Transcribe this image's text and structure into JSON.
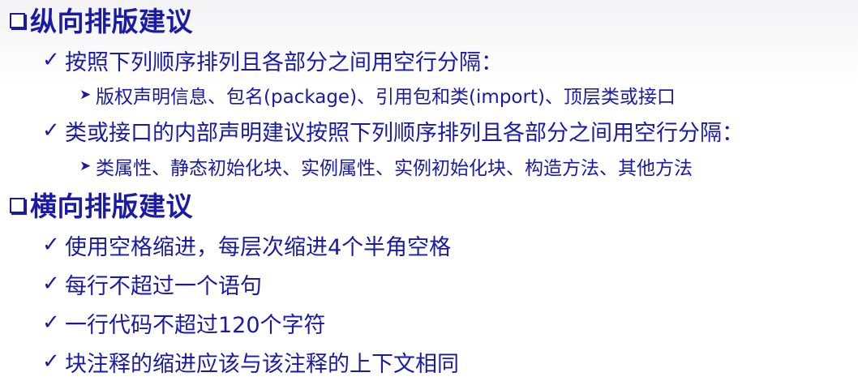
{
  "sections": [
    {
      "heading": "纵向排版建议",
      "bullets": [
        {
          "text": "按照下列顺序排列且各部分之间用空行分隔：",
          "sub": "版权声明信息、包名(package)、引用包和类(import)、顶层类或接口"
        },
        {
          "text": "类或接口的内部声明建议按照下列顺序排列且各部分之间用空行分隔：",
          "sub": "类属性、静态初始化块、实例属性、实例初始化块、构造方法、其他方法"
        }
      ]
    },
    {
      "heading": "横向排版建议",
      "bullets": [
        {
          "text": "使用空格缩进，每层次缩进4个半角空格"
        },
        {
          "text": "每行不超过一个语句"
        },
        {
          "text": "一行代码不超过120个字符"
        },
        {
          "text": "块注释的缩进应该与该注释的上下文相同"
        }
      ]
    }
  ],
  "icons": {
    "heading_bullet": "checkbox-square-icon",
    "level2_bullet": "checkmark-icon",
    "level3_bullet": "arrowhead-icon"
  },
  "colors": {
    "text": "#1a1aa6",
    "background": "#ffffff"
  }
}
